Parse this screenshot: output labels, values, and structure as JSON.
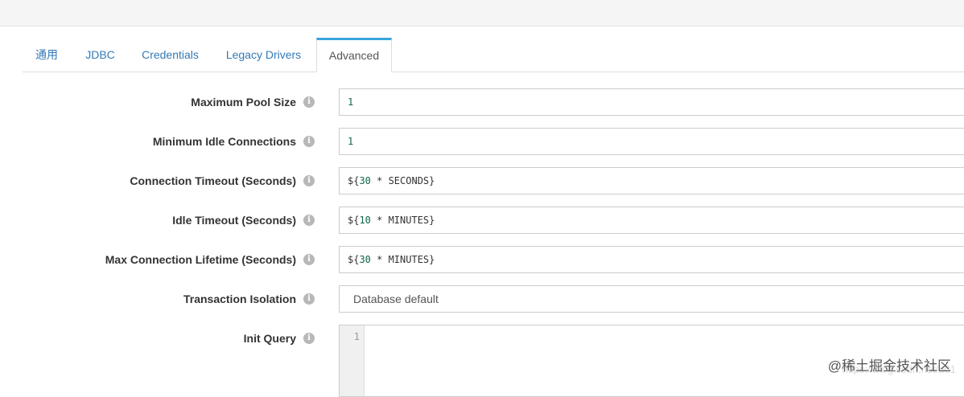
{
  "tabs": [
    {
      "label": "通用",
      "active": false
    },
    {
      "label": "JDBC",
      "active": false
    },
    {
      "label": "Credentials",
      "active": false
    },
    {
      "label": "Legacy Drivers",
      "active": false
    },
    {
      "label": "Advanced",
      "active": true
    }
  ],
  "form": {
    "max_pool_size": {
      "label": "Maximum Pool Size",
      "value": "1"
    },
    "min_idle": {
      "label": "Minimum Idle Connections",
      "value": "1"
    },
    "conn_timeout": {
      "label": "Connection Timeout (Seconds)",
      "prefix": "${",
      "num": "30",
      "suffix": " * SECONDS}"
    },
    "idle_timeout": {
      "label": "Idle Timeout (Seconds)",
      "prefix": "${",
      "num": "10",
      "suffix": " * MINUTES}"
    },
    "max_lifetime": {
      "label": "Max Connection Lifetime (Seconds)",
      "prefix": "${",
      "num": "30",
      "suffix": " * MINUTES}"
    },
    "tx_isolation": {
      "label": "Transaction Isolation",
      "value": "Database default"
    },
    "init_query": {
      "label": "Init Query",
      "line_number": "1"
    }
  },
  "info_glyph": "i",
  "watermark": {
    "text": "@稀土掘金技术社区",
    "url": "https://blog.csdn.net/u01"
  }
}
